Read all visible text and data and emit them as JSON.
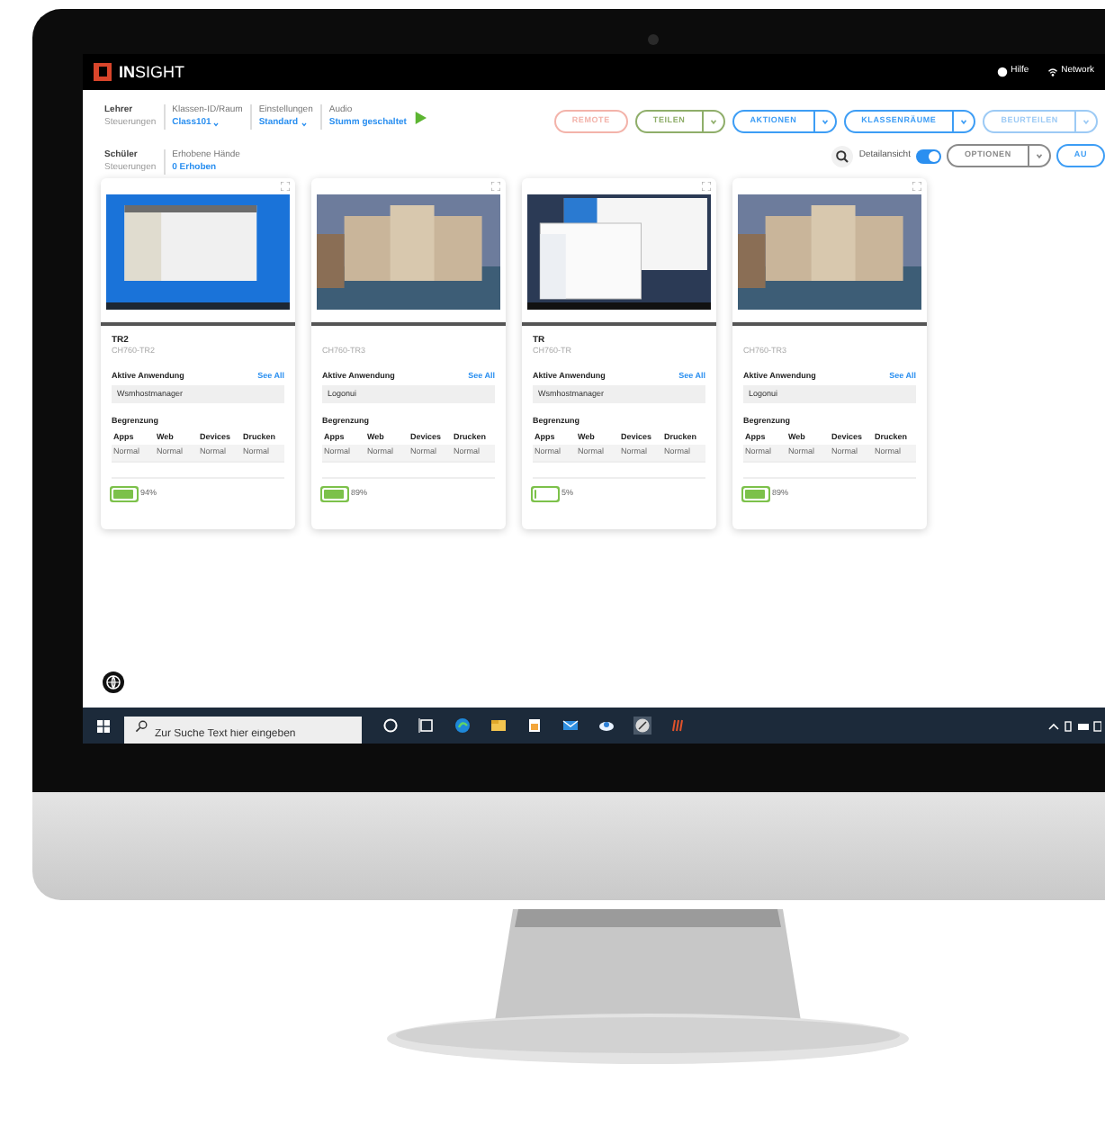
{
  "app": {
    "logo_text": "**IN**SIGHT",
    "header_links": [
      {
        "label": "Hilfe",
        "kind": "help"
      },
      {
        "label": "Network",
        "kind": "wifi"
      }
    ]
  },
  "control_groups": [
    {
      "title": "Lehrer",
      "subtitle": "Steuerungen",
      "fields": [
        {
          "label": "Klassen-ID/Raum",
          "value": "Class101",
          "kind": "dropdown"
        },
        {
          "label": "Einstellungen",
          "value": "Standard",
          "kind": "dropdown"
        },
        {
          "label": "Audio",
          "value": "Stumm geschaltet",
          "kind": "audio"
        }
      ]
    },
    {
      "title": "Schüler",
      "subtitle": "Steuerungen",
      "fields": [
        {
          "label": "Erhobene Hände",
          "value": "0 Erhoben",
          "kind": "text"
        }
      ]
    }
  ],
  "toolbar_buttons": [
    {
      "label": "REMOTE",
      "split": false,
      "color": "#f3b3aa"
    },
    {
      "label": "TEILEN",
      "split": true,
      "color": "#8fae6a"
    },
    {
      "label": "AKTIONEN",
      "split": true,
      "color": "#3d9df5"
    },
    {
      "label": "KLASSENRÄUME",
      "split": true,
      "color": "#3d9df5"
    },
    {
      "label": "BEURTEILEN",
      "split": true,
      "color": "#9ccaf5"
    }
  ],
  "view_bar": {
    "detail_label": "Detailansicht",
    "detail_on": true,
    "buttons": [
      {
        "label": "OPTIONEN",
        "split": true,
        "color": "#8a8a8a"
      },
      {
        "label": "AU",
        "split": false,
        "color": "#3d9df5"
      }
    ]
  },
  "cards": [
    {
      "name": "TR2",
      "device_id": "CH760-TR2",
      "kind": "desktop",
      "app_label": "Aktive Anwendung",
      "see_all": "See All",
      "app_value": "Wsmhostmanager",
      "limit_label": "Begrenzung",
      "columns": [
        "Apps",
        "Web",
        "Devices",
        "Drucken"
      ],
      "values": [
        "Normal",
        "Normal",
        "Normal",
        "Normal"
      ],
      "battery": "94%",
      "level": 0.9
    },
    {
      "device_id": "CH760-TR3",
      "kind": "photo",
      "app_label": "Aktive Anwendung",
      "see_all": "See All",
      "app_value": "Logonui",
      "limit_label": "Begrenzung",
      "columns": [
        "Apps",
        "Web",
        "Devices",
        "Drucken"
      ],
      "values": [
        "Normal",
        "Normal",
        "Normal",
        "Normal"
      ],
      "battery": "89%",
      "level": 0.9
    },
    {
      "name": "TR",
      "device_id": "CH760-TR",
      "kind": "explorer",
      "app_label": "Aktive Anwendung",
      "see_all": "See All",
      "app_value": "Wsmhostmanager",
      "limit_label": "Begrenzung",
      "columns": [
        "Apps",
        "Web",
        "Devices",
        "Drucken"
      ],
      "values": [
        "Normal",
        "Normal",
        "Normal",
        "Normal"
      ],
      "battery": "5%",
      "level": 0.1
    },
    {
      "device_id": "CH760-TR3",
      "kind": "photo",
      "app_label": "Aktive Anwendung",
      "see_all": "See All",
      "app_value": "Logonui",
      "limit_label": "Begrenzung",
      "columns": [
        "Apps",
        "Web",
        "Devices",
        "Drucken"
      ],
      "values": [
        "Normal",
        "Normal",
        "Normal",
        "Normal"
      ],
      "battery": "89%",
      "level": 0.9
    }
  ],
  "taskbar": {
    "search_placeholder": "Zur Suche Text hier eingeben"
  }
}
